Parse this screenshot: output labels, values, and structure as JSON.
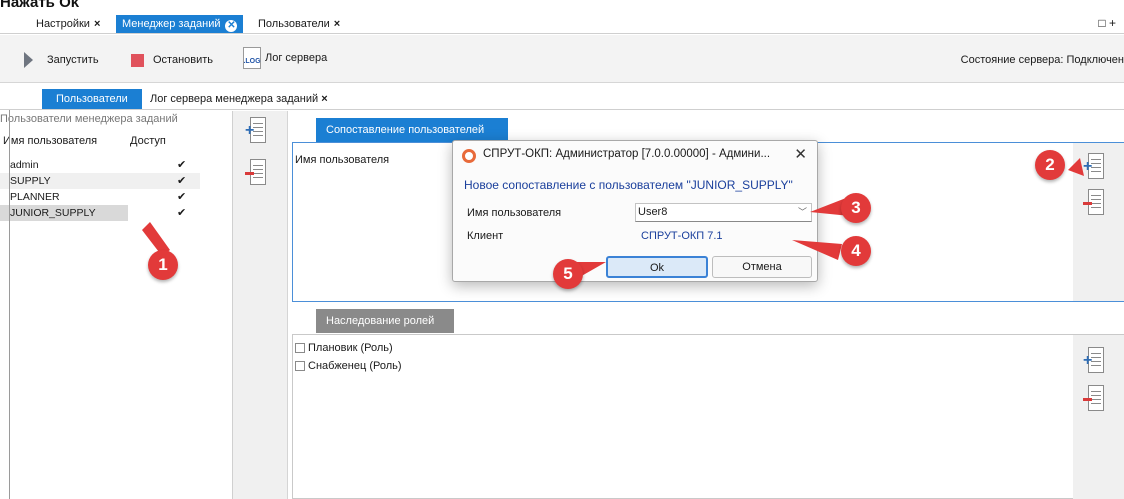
{
  "caption": "Нажать Ok",
  "tabs": [
    {
      "label": "Настройки",
      "close": "×"
    },
    {
      "label": "Менеджер заданий",
      "close": "✕"
    },
    {
      "label": "Пользователи",
      "close": "×"
    }
  ],
  "window_button": "□ +",
  "toolbar": {
    "start_label": "Запустить",
    "stop_label": "Остановить",
    "log_icon_text": ".LOG",
    "log_label": "Лог сервера",
    "status": "Состояние сервера: Подключен"
  },
  "subtabs": [
    {
      "label": "Пользователи"
    },
    {
      "label": "Лог сервера менеджера заданий",
      "close": "×"
    }
  ],
  "users_panel": {
    "group_header": "Пользователи менеджера заданий",
    "col_user": "Имя пользователя",
    "col_access": "Доступ",
    "rows": [
      {
        "name": "admin",
        "access": "✔"
      },
      {
        "name": "SUPPLY",
        "access": "✔"
      },
      {
        "name": "PLANNER",
        "access": "✔"
      },
      {
        "name": "JUNIOR_SUPPLY",
        "access": "✔"
      }
    ]
  },
  "mapping": {
    "tab_label": "Сопоставление пользователей",
    "column_label": "Имя пользователя"
  },
  "roles": {
    "tab_label": "Наследование ролей",
    "items": [
      {
        "label": "Плановик (Роль)",
        "checked": false
      },
      {
        "label": "Снабженец (Роль)",
        "checked": false
      }
    ]
  },
  "dialog": {
    "title": "СПРУТ-ОКП: Администратор [7.0.0.00000] - Админи...",
    "close": "✕",
    "heading": "Новое сопоставление с пользователем \"JUNIOR_SUPPLY\"",
    "user_label": "Имя пользователя",
    "user_value": "User8",
    "client_label": "Клиент",
    "client_value": "СПРУТ-ОКП 7.1",
    "ok_label": "Ok",
    "cancel_label": "Отмена"
  },
  "callouts": [
    "1",
    "2",
    "3",
    "4",
    "5"
  ],
  "colors": {
    "accent": "#1b7fd3",
    "callout": "#e23a3a",
    "stop": "#e0525c"
  }
}
